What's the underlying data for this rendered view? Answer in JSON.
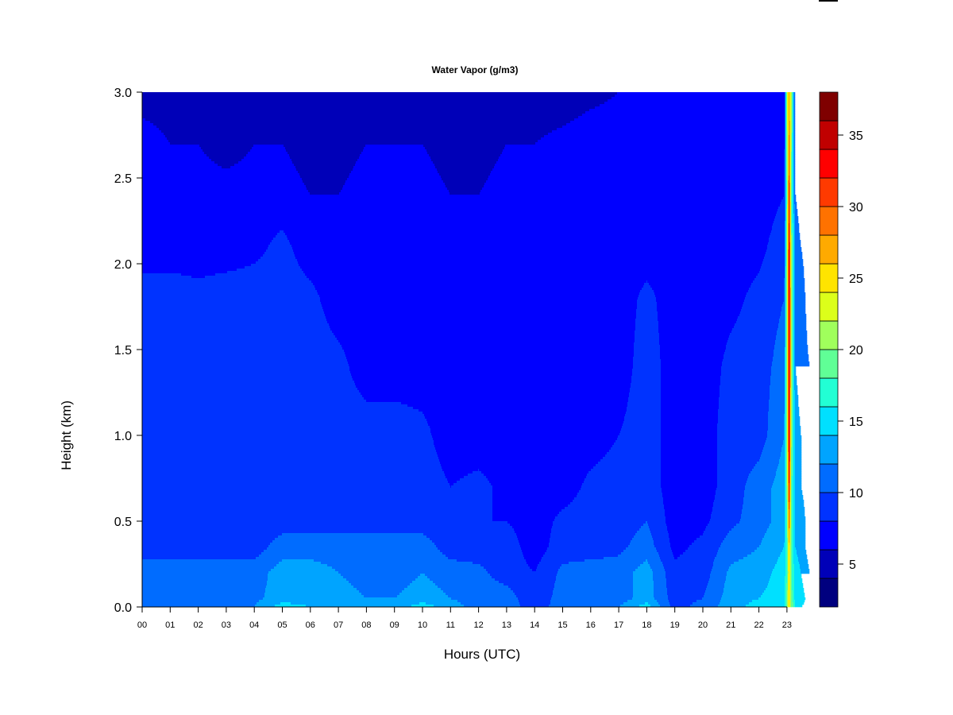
{
  "chart_data": {
    "type": "heatmap",
    "title": "Water Vapor (g/m3)",
    "xlabel": "Hours (UTC)",
    "ylabel": "Height (km)",
    "xlim": [
      0,
      24
    ],
    "ylim": [
      0,
      3.0
    ],
    "x_ticks": [
      "00",
      "01",
      "02",
      "03",
      "04",
      "05",
      "06",
      "07",
      "08",
      "09",
      "10",
      "11",
      "12",
      "13",
      "14",
      "15",
      "16",
      "17",
      "18",
      "19",
      "20",
      "21",
      "22",
      "23"
    ],
    "y_ticks": [
      "0.0",
      "0.5",
      "1.0",
      "1.5",
      "2.0",
      "2.5",
      "3.0"
    ],
    "y_tick_values": [
      0,
      0.5,
      1.0,
      1.5,
      2.0,
      2.5,
      3.0
    ],
    "colorbar": {
      "levels": [
        2,
        4,
        6,
        8,
        10,
        12,
        14,
        16,
        18,
        20,
        22,
        24,
        26,
        28,
        30,
        32,
        34,
        36,
        38
      ],
      "colors": [
        "#00007f",
        "#0000b8",
        "#0000ff",
        "#0033ff",
        "#006cff",
        "#00a4ff",
        "#00e0ff",
        "#22ffd4",
        "#60ff96",
        "#a0ff5c",
        "#dcff1a",
        "#ffe400",
        "#ffaa00",
        "#ff7200",
        "#ff3a00",
        "#ff0000",
        "#c00000",
        "#7f0000"
      ],
      "ticks": [
        "5",
        "10",
        "15",
        "20",
        "25",
        "30",
        "35"
      ],
      "tick_values": [
        5,
        10,
        15,
        20,
        25,
        30,
        35
      ]
    },
    "grid_heights_km": [
      0,
      0.05,
      0.2,
      0.35,
      0.5,
      0.7,
      1.0,
      1.4,
      1.8,
      2.1,
      2.4,
      2.7,
      3.0
    ],
    "grid_hours": [
      0,
      1,
      2,
      3,
      4,
      5,
      6,
      7,
      8,
      9,
      10,
      11,
      12,
      13,
      14,
      15,
      16,
      17,
      18,
      19,
      20,
      21,
      22,
      22.9,
      23.0,
      23.08,
      23.16,
      23.3,
      23.5,
      23.8
    ],
    "values": [
      [
        11,
        11,
        11,
        9,
        9,
        9,
        9,
        9,
        9,
        7,
        7,
        7,
        5
      ],
      [
        11,
        11,
        11,
        9,
        9,
        9,
        9,
        9,
        9,
        7,
        7,
        6,
        5
      ],
      [
        11,
        11,
        11,
        9,
        9,
        9,
        9,
        9,
        8.6,
        7,
        7,
        6,
        5
      ],
      [
        11,
        11,
        11,
        9,
        9,
        9,
        9,
        9,
        9,
        7,
        7,
        5,
        4
      ],
      [
        12,
        11.5,
        11,
        9,
        9,
        9,
        9,
        9,
        9,
        7.5,
        7,
        6,
        5
      ],
      [
        15,
        13,
        13,
        11,
        9,
        9,
        9,
        9,
        9,
        8.5,
        7,
        6,
        5
      ],
      [
        14,
        13,
        13,
        11,
        9,
        9,
        9,
        9,
        8.5,
        7,
        6,
        5,
        4
      ],
      [
        14,
        13,
        12,
        11,
        9,
        9,
        9,
        8.6,
        7,
        7,
        6,
        5,
        4
      ],
      [
        12,
        12,
        11,
        11,
        9,
        9,
        9,
        7,
        7,
        7,
        7,
        6,
        4.5
      ],
      [
        13,
        12,
        11,
        11,
        9,
        9,
        9,
        7,
        7,
        7,
        7,
        6,
        5
      ],
      [
        15,
        13,
        12,
        11,
        9,
        9,
        8.5,
        7,
        7,
        7,
        7,
        6,
        5
      ],
      [
        13,
        12,
        11,
        9,
        8.5,
        8,
        7,
        7,
        7,
        7,
        6,
        5,
        4
      ],
      [
        11,
        11,
        10.5,
        9,
        8,
        8.5,
        7,
        7,
        7,
        7,
        6,
        5,
        4
      ],
      [
        11,
        11,
        9,
        9,
        8,
        7.5,
        7,
        7,
        7,
        7,
        7,
        6,
        5
      ],
      [
        9,
        8.5,
        8,
        7,
        7,
        7,
        7,
        7,
        7,
        7,
        7,
        6,
        5
      ],
      [
        11,
        11,
        10.5,
        9,
        8.5,
        7,
        7,
        7,
        7,
        7,
        7,
        6.5,
        5
      ],
      [
        11,
        11,
        11,
        9,
        9,
        8.5,
        7,
        7,
        7,
        7,
        7,
        7,
        5.5
      ],
      [
        12,
        11,
        11,
        9.5,
        9,
        9,
        8,
        7,
        7,
        7,
        7,
        7,
        6
      ],
      [
        15,
        13,
        13,
        11,
        10,
        9,
        9,
        9,
        8.5,
        7,
        7,
        7,
        6
      ],
      [
        9,
        9,
        8.5,
        7.5,
        7,
        7,
        7,
        7,
        7,
        7,
        7,
        7,
        6
      ],
      [
        11,
        10,
        9,
        8.5,
        7.5,
        7,
        7,
        7,
        7,
        7,
        7,
        7,
        6.5
      ],
      [
        13,
        13,
        12.5,
        11,
        9.5,
        9,
        9,
        8.5,
        7.5,
        7,
        7,
        7,
        7
      ],
      [
        15,
        14,
        13,
        12,
        11,
        11,
        9,
        9,
        8.5,
        7.5,
        7,
        7,
        7
      ],
      [
        15,
        15,
        15,
        14,
        13,
        13,
        12,
        11,
        10,
        9,
        8,
        7.5,
        7
      ],
      [
        20,
        19,
        18,
        18,
        18,
        19,
        20,
        21,
        21,
        20,
        19,
        20,
        21
      ],
      [
        25,
        25,
        25,
        26,
        30,
        33,
        35,
        35,
        35,
        34,
        32,
        29,
        27
      ],
      [
        20,
        19,
        18,
        18,
        18,
        19,
        20,
        21,
        21,
        20,
        19,
        20,
        21
      ],
      [
        16,
        15,
        15,
        14,
        13,
        13,
        13,
        12,
        12,
        11,
        10,
        9,
        8
      ],
      [
        14,
        15,
        14,
        13,
        13,
        12,
        12,
        11,
        11,
        10,
        9,
        8,
        8
      ],
      [
        13,
        13,
        12,
        11,
        11,
        11,
        11,
        10,
        9,
        9,
        8.5,
        8,
        8
      ]
    ]
  }
}
